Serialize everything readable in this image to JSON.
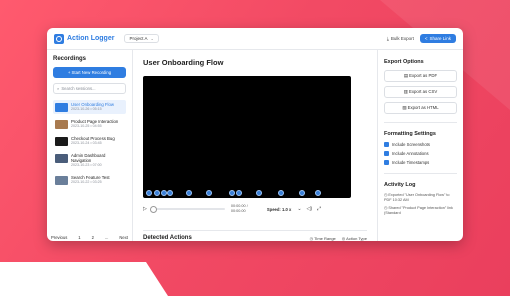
{
  "app": {
    "name": "Action Logger",
    "project": "Project A",
    "bulk_export": "Bulk Export",
    "share": "Share Link"
  },
  "sidebar": {
    "title": "Recordings",
    "new_recording": "+ Start New Recording",
    "search_placeholder": "Search sessions...",
    "sessions": [
      {
        "title": "User Onboarding Flow",
        "meta": "2023-10-26 • 05:15",
        "color": "#2f7de1"
      },
      {
        "title": "Product Page Interaction",
        "meta": "2023-10-25 • 04:55",
        "color": "#a87a4f"
      },
      {
        "title": "Checkout Process Bug",
        "meta": "2023-10-24 • 03:45",
        "color": "#1a1a1a"
      },
      {
        "title": "Admin Dashboard Navigation",
        "meta": "2023-10-23 • 07:00",
        "color": "#4a5d7a"
      },
      {
        "title": "Search Feature Test",
        "meta": "2023-10-22 • 03:25",
        "color": "#6a7f9a"
      }
    ],
    "pager": {
      "prev": "Previous",
      "p1": "1",
      "p2": "2",
      "ellipsis": "...",
      "next": "Next"
    }
  },
  "main": {
    "title": "User Onboarding Flow",
    "time_current": "00:00.00 /",
    "time_total": "00:00.00",
    "speed": "Speed: 1.0 x",
    "marker_count": 12,
    "detected": "Detected Actions",
    "time_range": "Time Range",
    "action_type": "Action Type"
  },
  "right": {
    "export_title": "Export Options",
    "export_pdf": "Export as PDF",
    "export_csv": "Export as CSV",
    "export_html": "Export as HTML",
    "format_title": "Formatting Settings",
    "include_screenshots": "Include Screenshots",
    "include_annotations": "Include Annotations",
    "include_timestamps": "Include Timestamps",
    "log_title": "Activity Log",
    "log1": "Exported \"User Onboarding Flow\" to PDF 10:32 AM",
    "log2": "Shared \"Product Page Interaction\" link (Standard"
  },
  "colors": {
    "accent": "#2f7de1",
    "background": "#f24a64"
  }
}
